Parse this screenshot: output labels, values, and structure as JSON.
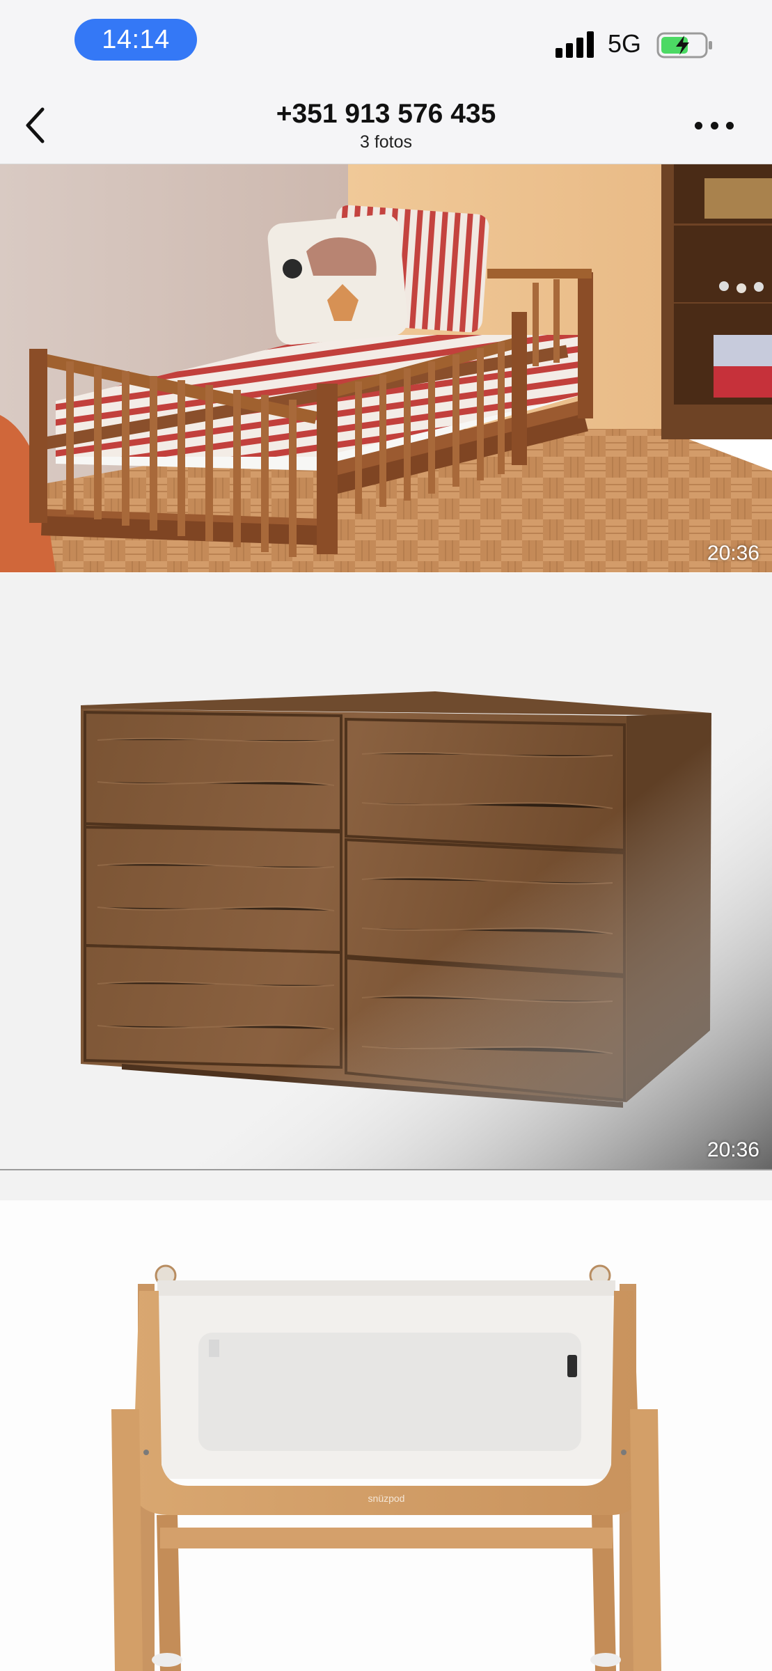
{
  "status_bar": {
    "time": "14:14",
    "network": "5G",
    "icons": [
      "signal-icon",
      "battery-charging-icon"
    ],
    "time_pill_color": "#3478f6",
    "battery_color": "#4cd964"
  },
  "header": {
    "title": "+351 913 576 435",
    "subtitle": "3 fotos",
    "back_icon": "chevron-left-icon",
    "more_icon": "ellipsis-icon"
  },
  "photos": [
    {
      "subject": "wooden floor bed with red striped bedding",
      "timestamp": "20:36"
    },
    {
      "subject": "walnut six-drawer dresser",
      "timestamp": "20:36"
    },
    {
      "subject": "bedside crib",
      "brand_mark": "snüzpod"
    }
  ]
}
